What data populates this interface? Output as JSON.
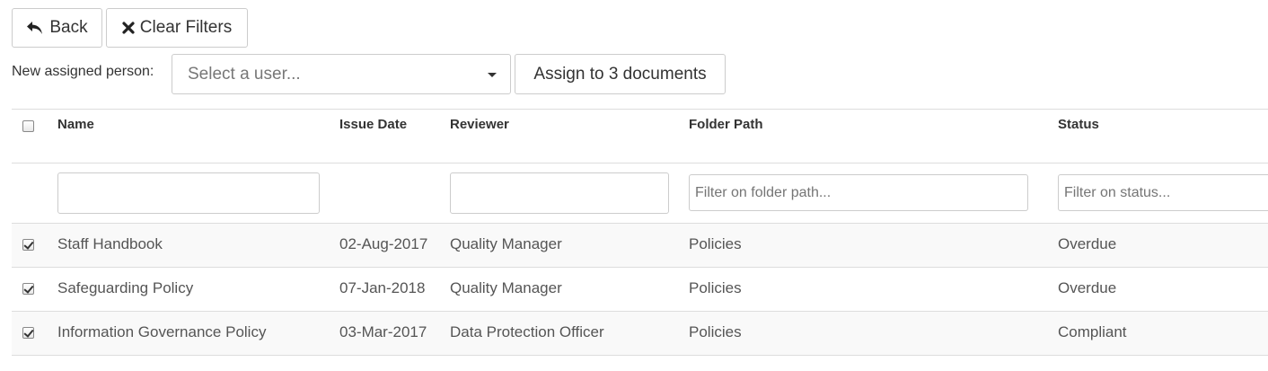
{
  "toolbar": {
    "back_label": "Back",
    "clear_filters_label": "Clear Filters"
  },
  "assign": {
    "label": "New assigned person:",
    "select_placeholder": "Select a user...",
    "assign_button_label": "Assign to 3 documents"
  },
  "table": {
    "columns": [
      "Name",
      "Issue Date",
      "Reviewer",
      "Folder Path",
      "Status"
    ],
    "filters": {
      "name": "",
      "reviewer": "",
      "folder_path_placeholder": "Filter on folder path...",
      "status_placeholder": "Filter on status..."
    },
    "rows": [
      {
        "checked": true,
        "name": "Staff Handbook",
        "issue_date": "02-Aug-2017",
        "reviewer": "Quality Manager",
        "folder_path": "Policies",
        "status": "Overdue"
      },
      {
        "checked": true,
        "name": "Safeguarding Policy",
        "issue_date": "07-Jan-2018",
        "reviewer": "Quality Manager",
        "folder_path": "Policies",
        "status": "Overdue"
      },
      {
        "checked": true,
        "name": "Information Governance Policy",
        "issue_date": "03-Mar-2017",
        "reviewer": "Data Protection Officer",
        "folder_path": "Policies",
        "status": "Compliant"
      }
    ]
  },
  "icons": {
    "back": "reply-arrow-icon",
    "clear": "x-icon",
    "dropdown": "caret-down-icon"
  }
}
